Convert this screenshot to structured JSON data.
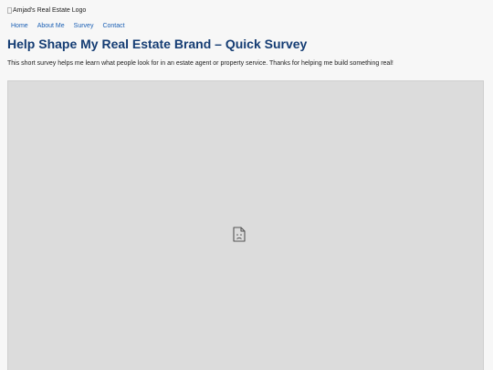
{
  "header": {
    "logo_alt": "Amjad's Real Estate Logo",
    "logo_icon": "broken-image-icon"
  },
  "nav": {
    "items": [
      {
        "label": "Home"
      },
      {
        "label": "About Me"
      },
      {
        "label": "Survey"
      },
      {
        "label": "Contact"
      }
    ],
    "link_color": "#1a5fb4"
  },
  "main": {
    "title": "Help Shape My Real Estate Brand – Quick Survey",
    "intro": "This short survey helps me learn what people look for in an estate agent or property service. Thanks for helping me build something real!",
    "title_color": "#143c73"
  },
  "embed": {
    "placeholder_icon": "broken-document-icon",
    "background": "#dcdcdc"
  }
}
